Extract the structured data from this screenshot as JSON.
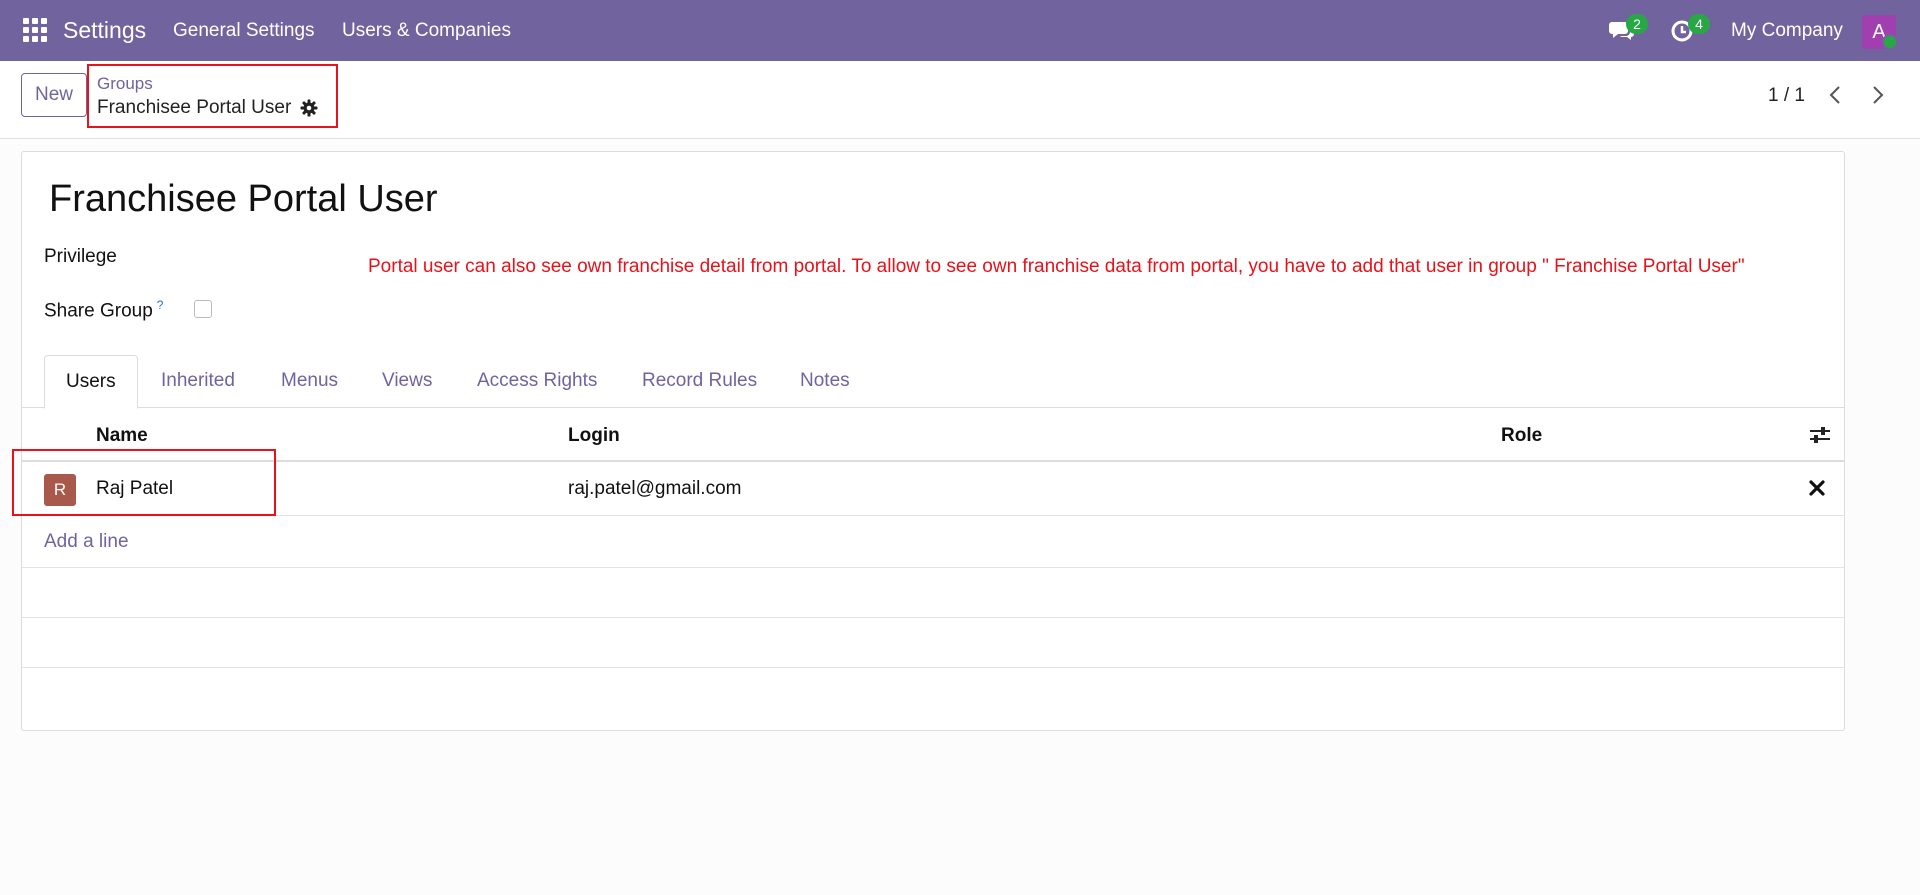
{
  "topbar": {
    "app_title": "Settings",
    "menu": [
      "General Settings",
      "Users & Companies"
    ],
    "chat_count": "2",
    "activity_count": "4",
    "company": "My Company",
    "avatar_initial": "A",
    "color": "#71639e"
  },
  "control_panel": {
    "new_label": "New",
    "breadcrumb_parent": "Groups",
    "breadcrumb_current": "Franchisee Portal User",
    "pager": "1 / 1"
  },
  "form": {
    "title": "Franchisee Portal User",
    "privilege_label": "Privilege",
    "share_group_label": "Share Group",
    "share_group_help": "?",
    "share_group_checked": false,
    "annotation": "Portal user can also see own franchise detail from portal. To allow to see own franchise data from portal, you have to add that user in group \" Franchise Portal User\""
  },
  "tabs": [
    {
      "label": "Users",
      "active": true
    },
    {
      "label": "Inherited"
    },
    {
      "label": "Menus"
    },
    {
      "label": "Views"
    },
    {
      "label": "Access Rights"
    },
    {
      "label": "Record Rules"
    },
    {
      "label": "Notes"
    }
  ],
  "table": {
    "columns": [
      "Name",
      "Login",
      "Role"
    ],
    "rows": [
      {
        "avatar_initial": "R",
        "name": "Raj Patel",
        "login": "raj.patel@gmail.com",
        "role": ""
      }
    ],
    "add_line_label": "Add a line"
  },
  "icons": {
    "apps": "apps-grid-icon",
    "chat": "chat-icon",
    "activity": "clock-icon",
    "gear": "gear-icon",
    "prev": "chevron-left-icon",
    "next": "chevron-right-icon",
    "optional_columns": "sliders-icon",
    "delete": "close-icon"
  }
}
